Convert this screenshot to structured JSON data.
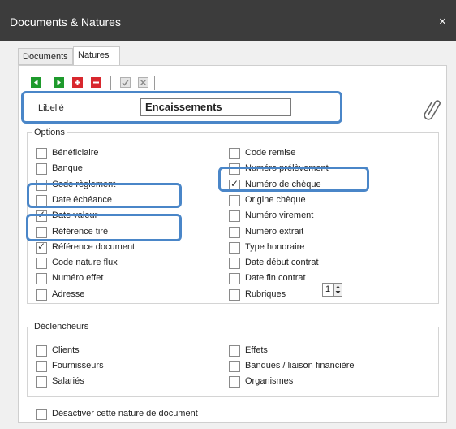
{
  "window": {
    "title": "Documents & Natures",
    "close_glyph": "×"
  },
  "tabs": [
    {
      "label": "Documents",
      "active": false
    },
    {
      "label": "Natures",
      "active": true
    }
  ],
  "toolbar": {
    "buttons": [
      {
        "name": "previous-icon",
        "color": "#1e9a2c"
      },
      {
        "name": "next-icon",
        "color": "#1e9a2c"
      },
      {
        "name": "add-icon",
        "color": "#d8282e"
      },
      {
        "name": "remove-icon",
        "color": "#d8282e"
      },
      {
        "name": "validate-icon",
        "color": "#9a9a9a"
      },
      {
        "name": "cancel-icon",
        "color": "#9a9a9a"
      }
    ]
  },
  "libelle": {
    "label": "Libellé",
    "value": "Encaissements"
  },
  "options": {
    "legend": "Options",
    "left": [
      {
        "label": "Bénéficiaire",
        "checked": false
      },
      {
        "label": "Banque",
        "checked": false
      },
      {
        "label": "Code règlement",
        "checked": false
      },
      {
        "label": "Date échéance",
        "checked": false
      },
      {
        "label": "Date valeur",
        "checked": true
      },
      {
        "label": "Référence tiré",
        "checked": false
      },
      {
        "label": "Référence document",
        "checked": true
      },
      {
        "label": "Code nature flux",
        "checked": false
      },
      {
        "label": "Numéro effet",
        "checked": false
      },
      {
        "label": "Adresse",
        "checked": false
      }
    ],
    "right": [
      {
        "label": "Code remise",
        "checked": false
      },
      {
        "label": "Numéro prélèvement",
        "checked": false
      },
      {
        "label": "Numéro de chèque",
        "checked": true
      },
      {
        "label": "Origine chèque",
        "checked": false
      },
      {
        "label": "Numéro virement",
        "checked": false
      },
      {
        "label": "Numéro extrait",
        "checked": false
      },
      {
        "label": "Type honoraire",
        "checked": false
      },
      {
        "label": "Date début contrat",
        "checked": false
      },
      {
        "label": "Date fin contrat",
        "checked": false
      },
      {
        "label": "Rubriques",
        "checked": false
      }
    ],
    "rubriques_value": "1"
  },
  "declencheurs": {
    "legend": "Déclencheurs",
    "left": [
      {
        "label": "Clients",
        "checked": false
      },
      {
        "label": "Fournisseurs",
        "checked": false
      },
      {
        "label": "Salariés",
        "checked": false
      }
    ],
    "right": [
      {
        "label": "Effets",
        "checked": false
      },
      {
        "label": "Banques / liaison financière",
        "checked": false
      },
      {
        "label": "Organismes",
        "checked": false
      }
    ]
  },
  "disable_option": {
    "label": "Désactiver cette nature de document",
    "checked": false
  },
  "highlight_color": "#4a86c8"
}
